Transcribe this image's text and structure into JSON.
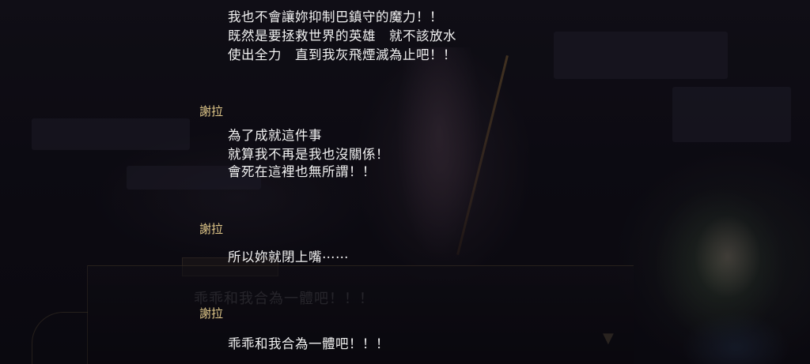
{
  "scene": {
    "ghost_dialogue": "乖乖和我合為一體吧！！！"
  },
  "log": {
    "entries": [
      {
        "speaker": "",
        "lines": [
          "我也不會讓妳抑制巴鎮守的魔力！！",
          "既然是要拯救世界的英雄　就不該放水",
          "使出全力　直到我灰飛煙滅為止吧！！"
        ]
      },
      {
        "speaker": "謝拉",
        "lines": [
          "為了成就這件事",
          "就算我不再是我也沒關係！",
          "會死在這裡也無所謂！！"
        ]
      },
      {
        "speaker": "謝拉",
        "lines": [
          "所以妳就閉上嘴⋯⋯"
        ]
      },
      {
        "speaker": "謝拉",
        "lines": [
          "乖乖和我合為一體吧！！！"
        ]
      }
    ]
  }
}
